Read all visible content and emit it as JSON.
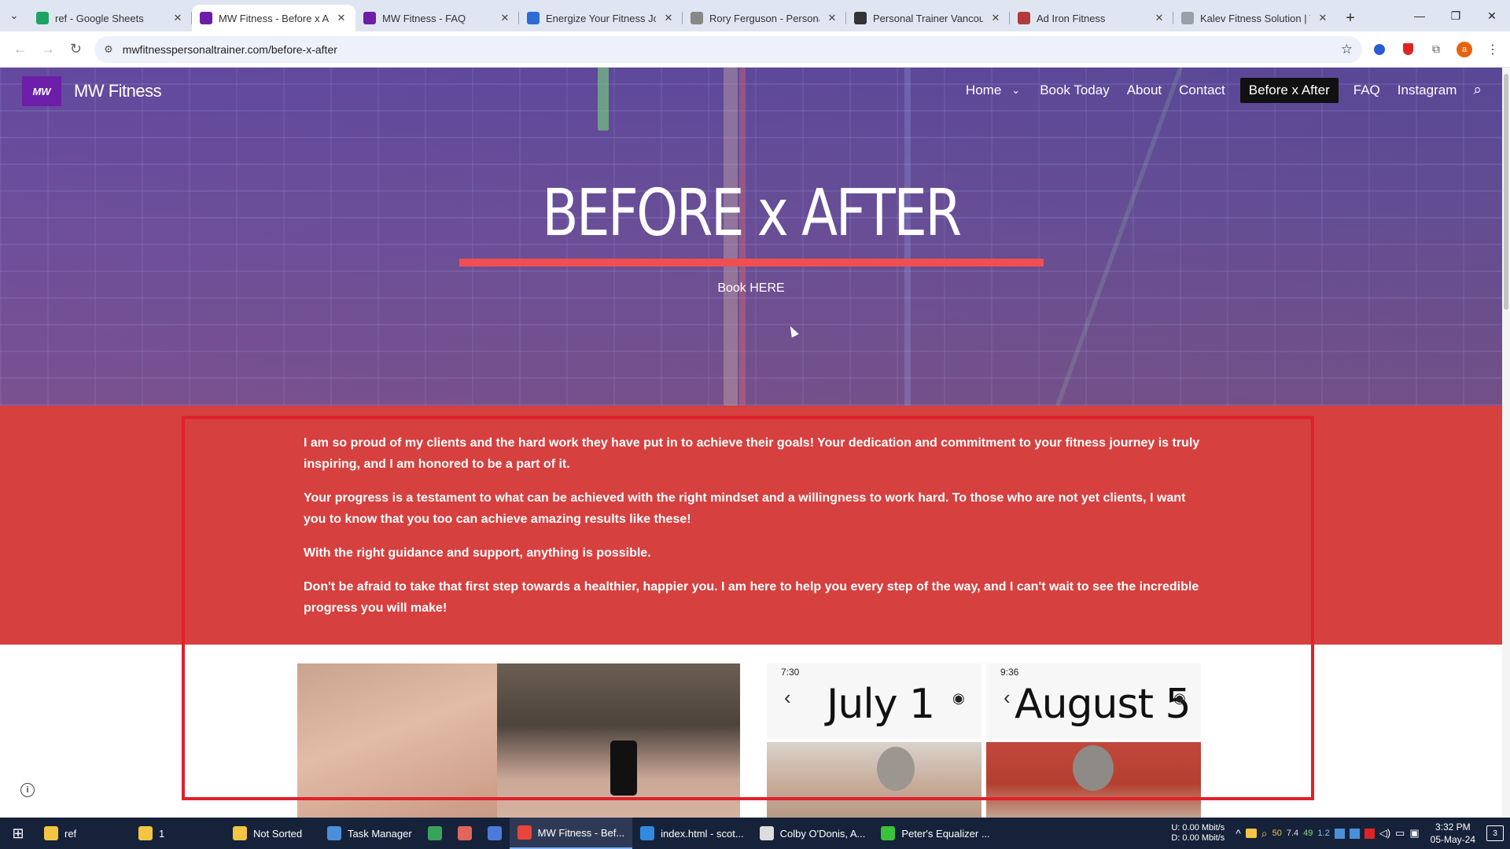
{
  "browser": {
    "tabs": [
      {
        "title": "ref - Google Sheets",
        "color": "#1ea362"
      },
      {
        "title": "MW Fitness - Before x Afte",
        "color": "#6c1ea8",
        "active": true
      },
      {
        "title": "MW Fitness - FAQ",
        "color": "#6c1ea8"
      },
      {
        "title": "Energize Your Fitness Jour",
        "color": "#2b6cd6"
      },
      {
        "title": "Rory Ferguson - Personal",
        "color": "#888888"
      },
      {
        "title": "Personal Trainer Vancouv",
        "color": "#333333"
      },
      {
        "title": "Ad Iron Fitness",
        "color": "#b33a3a"
      },
      {
        "title": "Kalev Fitness Solution | To",
        "color": "#9aa0a6"
      }
    ],
    "new_tab": "+",
    "url": "mwfitnesspersonaltrainer.com/before-x-after",
    "profile_initial": "a",
    "controls": {
      "back": "←",
      "forward": "→",
      "reload": "↻",
      "site_info": "⚙",
      "bookmark": "☆",
      "more": "⋮",
      "tab_search": "⌄",
      "minimize": "—",
      "restore": "❐",
      "close": "✕",
      "close_tab": "✕"
    }
  },
  "site": {
    "logo_text": "MW",
    "brand": "MW Fitness",
    "nav": [
      {
        "label": "Home"
      },
      {
        "label": "Book Today"
      },
      {
        "label": "About"
      },
      {
        "label": "Contact"
      },
      {
        "label": "Before x After",
        "current": true
      },
      {
        "label": "FAQ"
      },
      {
        "label": "Instagram"
      }
    ],
    "nav_chevron": "⌄",
    "search_glyph": "⌕",
    "hero": {
      "title": "BEFORE x AFTER",
      "cta": "Book HERE"
    },
    "paragraphs": [
      "I am so proud of my clients and the hard work they have put in to achieve their goals! Your dedication and commitment to your fitness journey is truly inspiring, and I am honored to be a part of it.",
      "Your progress is a testament to what can be achieved with the right mindset and a willingness to work hard. To those who are not yet clients, I want you to know that you too can achieve amazing results like these!",
      "With the right guidance and support, anything is possible.",
      "Don't be afraid to take that first step towards a healthier, happier you. I am here to help you every step of the way, and I can't wait to see the incredible progress you will make!"
    ],
    "phone_left": {
      "status_time": "7:30",
      "date": "July 1"
    },
    "phone_right": {
      "status_time": "9:36",
      "date": "August 5"
    },
    "phone_back": "‹",
    "phone_eye": "◉",
    "info_glyph": "i",
    "colors": {
      "accent_red": "#d6403f",
      "line_red": "#f04f52",
      "brand_purple": "#6c1ea8",
      "highlight": "#e0202a"
    }
  },
  "taskbar": {
    "start_glyph": "⊞",
    "items": [
      {
        "label": "ref",
        "color": "#f4c542"
      },
      {
        "label": "1",
        "color": "#f4c542"
      },
      {
        "label": "Not Sorted",
        "color": "#f4c542"
      },
      {
        "label": "Task Manager",
        "color": "#4a90d9"
      },
      {
        "label": "",
        "color": "#3aa35b"
      },
      {
        "label": "",
        "color": "#e0655a"
      },
      {
        "label": "",
        "color": "#4a7bd9"
      },
      {
        "label": "MW Fitness - Bef...",
        "color": "#e8453c",
        "active": true
      },
      {
        "label": "index.html - scot...",
        "color": "#2f8ae0"
      },
      {
        "label": "Colby O'Donis, A...",
        "color": "#dddddd"
      },
      {
        "label": "Peter's Equalizer ...",
        "color": "#39c339"
      }
    ],
    "net_up": "U:    0.00 Mbit/s",
    "net_down": "D:    0.00 Mbit/s",
    "tray_glyph": "^",
    "tray_numbers": [
      "50",
      "7.4",
      "49",
      "1.2"
    ],
    "time": "3:32 PM",
    "date": "05-May-24",
    "notifications": "3"
  }
}
